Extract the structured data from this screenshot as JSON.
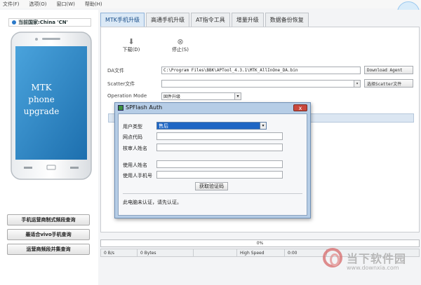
{
  "menu": [
    "文件(F)",
    "选项(O)",
    "窗口(W)",
    "帮助(H)"
  ],
  "speed_badge": "0KB/s",
  "country": {
    "label": "当前国家:China 'CN'"
  },
  "phone": {
    "screen_text_line1": "MTK phone",
    "screen_text_line2": "upgrade"
  },
  "side_buttons": [
    "手机运营商制式频段查询",
    "最适合vivo手机查询",
    "运营商频段并集查询"
  ],
  "tabs": [
    {
      "label": "MTK手机升级",
      "active": true
    },
    {
      "label": "高通手机升级",
      "active": false
    },
    {
      "label": "AT指令工具",
      "active": false
    },
    {
      "label": "增量升级",
      "active": false
    },
    {
      "label": "数据备份恢复",
      "active": false
    }
  ],
  "toolbar": {
    "download_label": "下载(D)",
    "stop_label": "停止(S)"
  },
  "form": {
    "da_label": "DA文件",
    "da_value": "C:\\Program Files\\BBK\\APTool_4.3.1\\MTK_AllInOne_DA.bin",
    "download_agent_button": "Download Agent",
    "scatter_label": "Scatter文件",
    "scatter_value": "",
    "scatter_button": "选择Scatter文件",
    "mode_label": "Operation Mode",
    "mode_value": "固件升级"
  },
  "dialog": {
    "title": "SPFlash Auth",
    "close_label": "x",
    "user_type_label": "用户类型",
    "user_type_value": "售后",
    "outlet_code_label": "网点代码",
    "reviewer_label": "核审人姓名",
    "user_name_label": "使用人姓名",
    "user_phone_label": "使用人手机号",
    "get_code_button": "获取验证码",
    "footer": "此电脑未认证，请先认证。"
  },
  "progress": {
    "percent_text": "0%",
    "value": 0
  },
  "status": {
    "speed": "0 B/s",
    "bytes": "0 Bytes",
    "mode": "High Speed",
    "time": "0:00"
  },
  "watermark": {
    "title": "当下软件园",
    "url": "www.downxia.com"
  },
  "colors": {
    "accent": "#1e66c4",
    "tab_active": "#dbe9f6",
    "dialog_frame": "#b6cde6"
  }
}
